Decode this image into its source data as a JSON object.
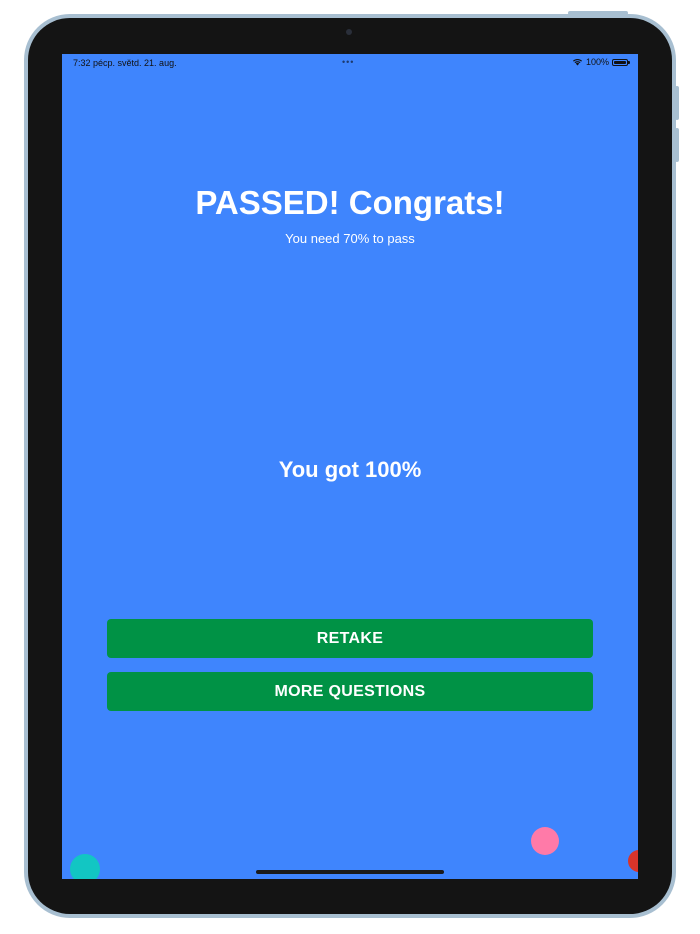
{
  "status_bar": {
    "time_date": "7:32 pécp.   světd. 21. aug.",
    "center_dots": "•••",
    "battery_text": "100%",
    "battery_level": 1.0
  },
  "result": {
    "title": "PASSED! Congrats!",
    "subtitle": "You need 70% to pass",
    "score_text": "You got 100%"
  },
  "actions": {
    "retake_label": "RETAKE",
    "more_label": "MORE QUESTIONS"
  },
  "colors": {
    "background": "#3f85fd",
    "button": "#009245",
    "text": "#ffffff",
    "confetti": [
      "#12c6c3",
      "#ff7aa8",
      "#d8342a"
    ]
  },
  "icons": {
    "wifi": "wifi-icon",
    "battery": "battery-icon"
  }
}
